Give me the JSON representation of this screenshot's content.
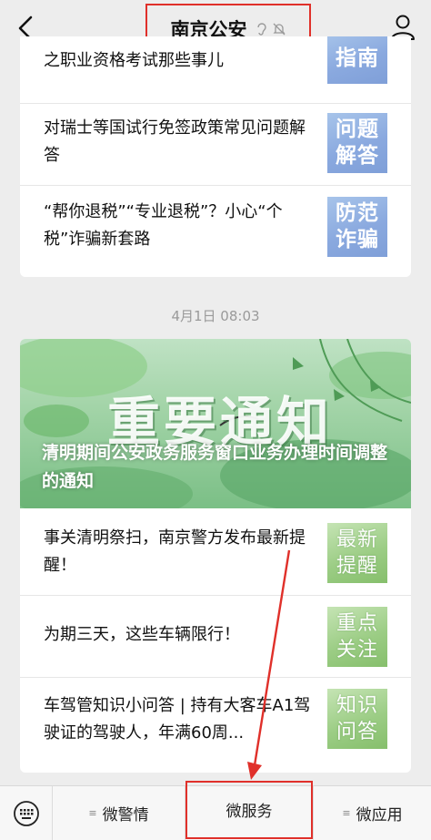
{
  "header": {
    "title": "南京公安",
    "icons": [
      "back-arrow-icon",
      "ear-icon",
      "bell-muted-icon",
      "profile-icon"
    ]
  },
  "feed_top": {
    "articles": [
      {
        "text": "之职业资格考试那些事儿",
        "thumb": [
          "指南"
        ],
        "thumb_style": "blue"
      },
      {
        "text": "对瑞士等国试行免签政策常见问题解答",
        "thumb": [
          "问题",
          "解答"
        ],
        "thumb_style": "blue"
      },
      {
        "text": "“帮你退税”“专业退税”？小心“个税”诈骗新套路",
        "thumb": [
          "防范",
          "诈骗"
        ],
        "thumb_style": "blue"
      }
    ]
  },
  "timestamp": "4月1日 08:03",
  "feed_main": {
    "banner": {
      "big_text": "重要通知",
      "caption": "清明期间公安政务服务窗口业务办理时间调整的通知"
    },
    "articles": [
      {
        "text": "事关清明祭扫，南京警方发布最新提醒！",
        "thumb": [
          "最新",
          "提醒"
        ],
        "thumb_style": "green"
      },
      {
        "text": "为期三天，这些车辆限行！",
        "thumb": [
          "重点",
          "关注"
        ],
        "thumb_style": "green"
      },
      {
        "text": "车驾管知识小问答 | 持有大客车A1驾驶证的驾驶人，年满60周...",
        "thumb": [
          "知识",
          "问答"
        ],
        "thumb_style": "green"
      }
    ]
  },
  "bottom_menu": {
    "items": [
      {
        "label": "微警情",
        "icon": "menu-lines-icon"
      },
      {
        "label": "微服务",
        "icon": ""
      },
      {
        "label": "微应用",
        "icon": "menu-lines-icon"
      }
    ],
    "keyboard_icon": "keyboard-icon"
  },
  "colors": {
    "highlight_red": "#e0302a",
    "background": "#ededed",
    "thumb_blue": "#8aa9df",
    "thumb_green": "#9ccd85"
  }
}
